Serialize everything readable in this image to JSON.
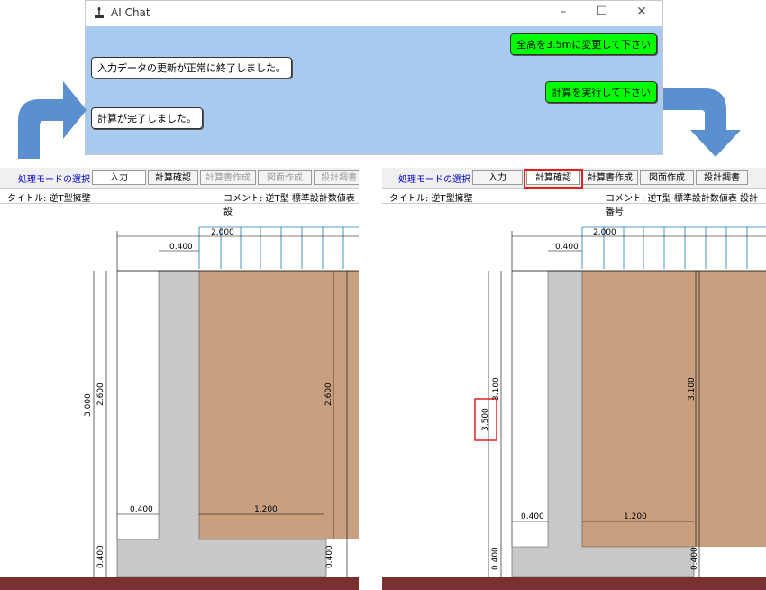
{
  "chat": {
    "title": "AI Chat",
    "messages": [
      {
        "role": "user",
        "text": "全高を3.5mに変更して下さい"
      },
      {
        "role": "system",
        "text": "入力データの更新が正常に終了しました。"
      },
      {
        "role": "user",
        "text": "計算を実行して下さい"
      },
      {
        "role": "system",
        "text": "計算が完了しました。"
      }
    ],
    "icons": [
      "app-icon",
      "minimize-icon",
      "maximize-icon",
      "close-icon"
    ]
  },
  "left_pane": {
    "toolbar": {
      "mode_label": "処理モードの選択",
      "buttons": [
        {
          "label": "入力",
          "state": "active"
        },
        {
          "label": "計算確認",
          "state": "enabled"
        },
        {
          "label": "計算書作成",
          "state": "disabled"
        },
        {
          "label": "図面作成",
          "state": "disabled"
        },
        {
          "label": "設計調書",
          "state": "disabled"
        }
      ]
    },
    "info": {
      "title": "タイトル: 逆T型擁壁",
      "comment": "コメント: 逆T型 標準設計数値表 設"
    },
    "dims": {
      "top_load": "2.000",
      "top_wall": "0.400",
      "total_height": "3.000",
      "stem_height": "2.600",
      "heel_height": "2.600",
      "toe": "0.400",
      "heel": "1.200",
      "base_left": "0.400",
      "base_right": "0.400"
    }
  },
  "right_pane": {
    "toolbar": {
      "mode_label": "処理モードの選択",
      "buttons": [
        {
          "label": "入力",
          "state": "enabled"
        },
        {
          "label": "計算確認",
          "state": "active"
        },
        {
          "label": "計算書作成",
          "state": "enabled"
        },
        {
          "label": "図面作成",
          "state": "enabled"
        },
        {
          "label": "設計調書",
          "state": "enabled"
        }
      ]
    },
    "info": {
      "title": "タイトル: 逆T型擁壁",
      "comment": "コメント: 逆T型 標準設計数値表 設計番号"
    },
    "dims": {
      "top_load": "2.000",
      "top_wall": "0.400",
      "total_height": "3.500",
      "stem_height": "3.100",
      "heel_height": "3.100",
      "toe": "0.400",
      "heel": "1.200",
      "base_left": "0.400",
      "base_right": "0.400"
    }
  },
  "colors": {
    "chat_bg": "#a9caf0",
    "user_bubble": "#00ff00",
    "soil": "#c8a080",
    "concrete": "#c8c8c8",
    "ground": "#7a3030",
    "load_arrows": "#1a7ab0",
    "arrow_fill": "#5a8fd0",
    "highlight": "#e02020"
  }
}
